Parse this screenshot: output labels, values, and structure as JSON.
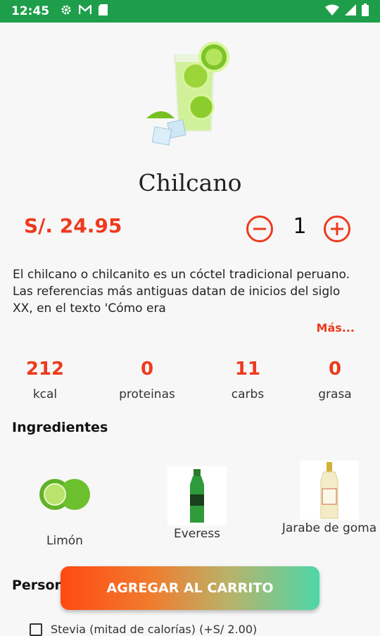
{
  "status_bar": {
    "time": "12:45",
    "left_icons": [
      "gear-icon",
      "gmail-icon",
      "sd-card-icon"
    ],
    "right_icons": [
      "wifi-icon",
      "signal-icon",
      "battery-icon"
    ],
    "color": "#1e9e4a"
  },
  "product": {
    "name": "Chilcano",
    "price": "S/. 24.95",
    "quantity": "1",
    "description": "El chilcano o chilcanito es un cóctel tradicional peruano. Las referencias más antiguas datan de inicios del siglo XX, en el texto 'Cómo era",
    "more_label": "Más..."
  },
  "nutrition": [
    {
      "value": "212",
      "label": "kcal"
    },
    {
      "value": "0",
      "label": "proteinas"
    },
    {
      "value": "11",
      "label": "carbs"
    },
    {
      "value": "0",
      "label": "grasa"
    }
  ],
  "ingredients_section": {
    "title": "Ingredientes",
    "items": [
      {
        "name": "Limón"
      },
      {
        "name": "Everess"
      },
      {
        "name": "Jarabe de goma"
      }
    ]
  },
  "personalize_section": {
    "title": "Person",
    "options": [
      {
        "label": "Stevia (mitad de calorías) (+S/ 2.00)",
        "checked": false
      }
    ]
  },
  "cta": {
    "label": "AGREGAR AL CARRITO"
  },
  "colors": {
    "accent": "#ee3a1e",
    "status": "#1e9e4a",
    "gradient_start": "#ff4a12",
    "gradient_end": "#4ed6a8"
  }
}
